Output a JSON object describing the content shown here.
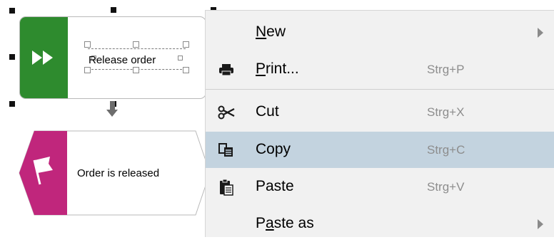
{
  "diagram": {
    "function": {
      "label": "Release order",
      "icon": "fast-forward-icon",
      "color": "#2e8b2e"
    },
    "event": {
      "label": "Order is released",
      "icon": "flag-icon",
      "color": "#c0267c"
    }
  },
  "context_menu": {
    "items": [
      {
        "label": "New",
        "mnemonic": "N",
        "shortcut": "",
        "icon": "",
        "has_submenu": true
      },
      {
        "label": "Print...",
        "mnemonic": "P",
        "shortcut": "Strg+P",
        "icon": "printer-icon",
        "has_submenu": false
      },
      {
        "label": "Cut",
        "mnemonic": "",
        "shortcut": "Strg+X",
        "icon": "scissors-icon",
        "has_submenu": false
      },
      {
        "label": "Copy",
        "mnemonic": "",
        "shortcut": "Strg+C",
        "icon": "copy-icon",
        "has_submenu": false,
        "highlighted": true
      },
      {
        "label": "Paste",
        "mnemonic": "",
        "shortcut": "Strg+V",
        "icon": "paste-icon",
        "has_submenu": false
      },
      {
        "label": "Paste as",
        "mnemonic": "a",
        "shortcut": "",
        "icon": "",
        "has_submenu": true
      }
    ],
    "highlight_color": "#c3d3df",
    "background_color": "#f1f1f1"
  }
}
